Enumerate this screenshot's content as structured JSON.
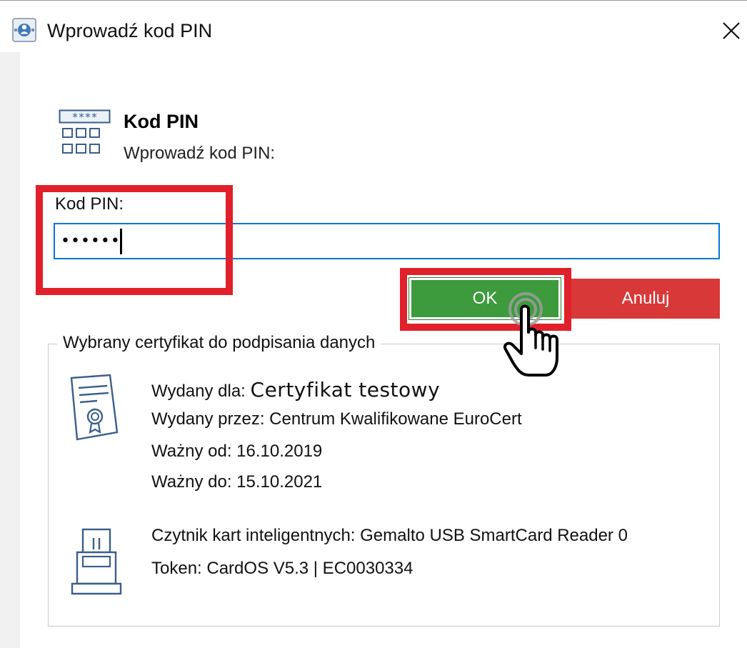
{
  "window": {
    "title": "Wprowadź kod PIN",
    "app_icon": "smartcard-app-icon",
    "close_icon": "close-icon"
  },
  "header": {
    "title": "Kod PIN",
    "subtitle": "Wprowadź kod PIN:",
    "icon": "pin-keypad-icon"
  },
  "pin": {
    "label": "Kod PIN:",
    "value": "••••••"
  },
  "buttons": {
    "ok_label": "OK",
    "cancel_label": "Anuluj"
  },
  "certificate": {
    "group_label": "Wybrany certyfikat do podpisania danych",
    "issued_to_label": "Wydany dla:",
    "issued_to_value": "Certyfikat testowy",
    "issued_by": "Wydany przez: Centrum Kwalifikowane EuroCert",
    "valid_from": "Ważny od: 16.10.2019",
    "valid_to": "Ważny do: 15.10.2021",
    "icon": "certificate-icon"
  },
  "reader": {
    "reader_line": "Czytnik kart inteligentnych: Gemalto USB SmartCard Reader 0",
    "token_line": "Token: CardOS V5.3 | EC0030334",
    "icon": "card-reader-icon"
  },
  "colors": {
    "ok_green": "#3d9a3d",
    "cancel_red": "#d93838",
    "highlight_red": "#e0202a",
    "focus_blue": "#0078d7"
  }
}
